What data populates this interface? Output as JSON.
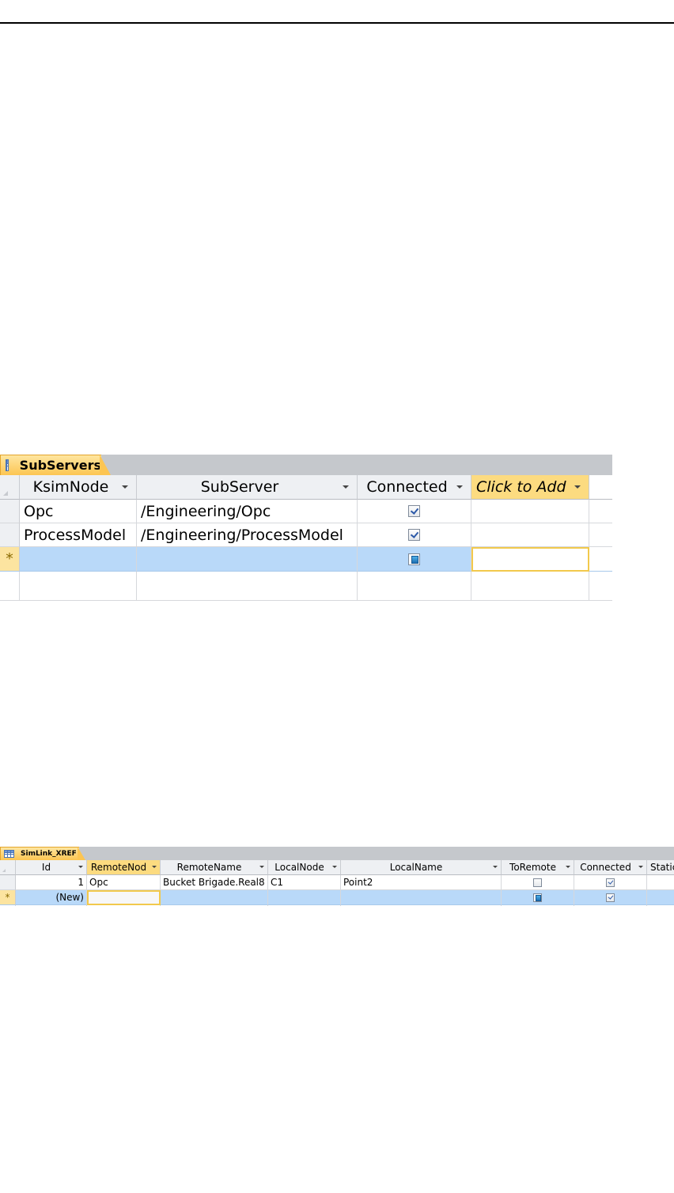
{
  "subservers": {
    "tab_title": "SubServers",
    "columns": [
      "KsimNode",
      "SubServer",
      "Connected",
      "Click to Add"
    ],
    "rows": [
      {
        "ksim_node": "Opc",
        "sub_server": "/Engineering/Opc",
        "connected": true
      },
      {
        "ksim_node": "ProcessModel",
        "sub_server": "/Engineering/ProcessModel",
        "connected": true
      }
    ],
    "new_row_marker": "*"
  },
  "simlink": {
    "tab_title": "SimLink_XREF",
    "columns": [
      "Id",
      "RemoteNod",
      "RemoteName",
      "LocalNode",
      "LocalName",
      "ToRemote",
      "Connected",
      "Static"
    ],
    "rows": [
      {
        "id": "1",
        "remote_node": "Opc",
        "remote_name": "Bucket Brigade.Real8",
        "local_node": "C1",
        "local_name": "Point2",
        "to_remote": false,
        "connected": true
      }
    ],
    "new_row": {
      "id": "(New)",
      "connected": true
    },
    "new_row_marker": "*"
  },
  "colors": {
    "accent": "#fcc552",
    "selection": "#b9d9f9",
    "header": "#eef0f3"
  }
}
